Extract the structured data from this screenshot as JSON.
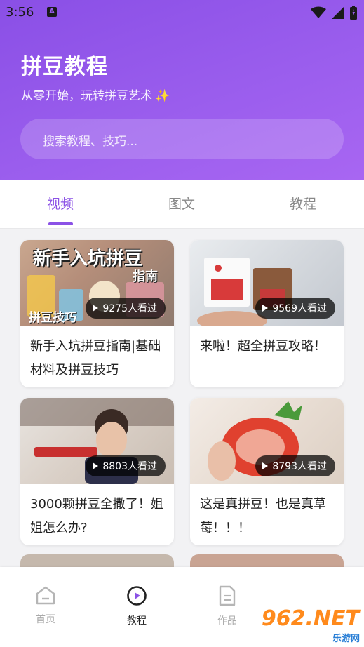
{
  "status_bar": {
    "time": "3:56",
    "notification_icon": "a-letter-icon",
    "icons": [
      "wifi-icon",
      "signal-icon",
      "battery-icon"
    ]
  },
  "header": {
    "title": "拼豆教程",
    "subtitle": "从零开始，玩转拼豆艺术",
    "sparkle": "✨"
  },
  "search": {
    "placeholder": "搜索教程、技巧..."
  },
  "tabs": [
    {
      "label": "视频",
      "active": true
    },
    {
      "label": "图文",
      "active": false
    },
    {
      "label": "教程",
      "active": false
    }
  ],
  "cards": [
    {
      "title": "新手入坑拼豆指南|基础材料及拼豆技巧",
      "views": "9275人看过",
      "thumb_text": [
        "新手入坑拼豆",
        "指南",
        "拼豆技巧"
      ]
    },
    {
      "title": "来啦！超全拼豆攻略！",
      "views": "9569人看过"
    },
    {
      "title": "3000颗拼豆全撒了！姐姐怎么办?",
      "views": "8803人看过"
    },
    {
      "title": "这是真拼豆！也是真草莓！！！",
      "views": "8793人看过"
    }
  ],
  "bottom_nav": [
    {
      "label": "首页",
      "icon": "home-icon",
      "active": false
    },
    {
      "label": "教程",
      "icon": "play-circle-icon",
      "active": true
    },
    {
      "label": "作品",
      "icon": "document-icon",
      "active": false
    }
  ],
  "watermark": {
    "main": "962.NET",
    "sub": "乐游网"
  },
  "colors": {
    "accent": "#8b52e6",
    "header_start": "#8a4fe6",
    "header_end": "#a866f2"
  }
}
